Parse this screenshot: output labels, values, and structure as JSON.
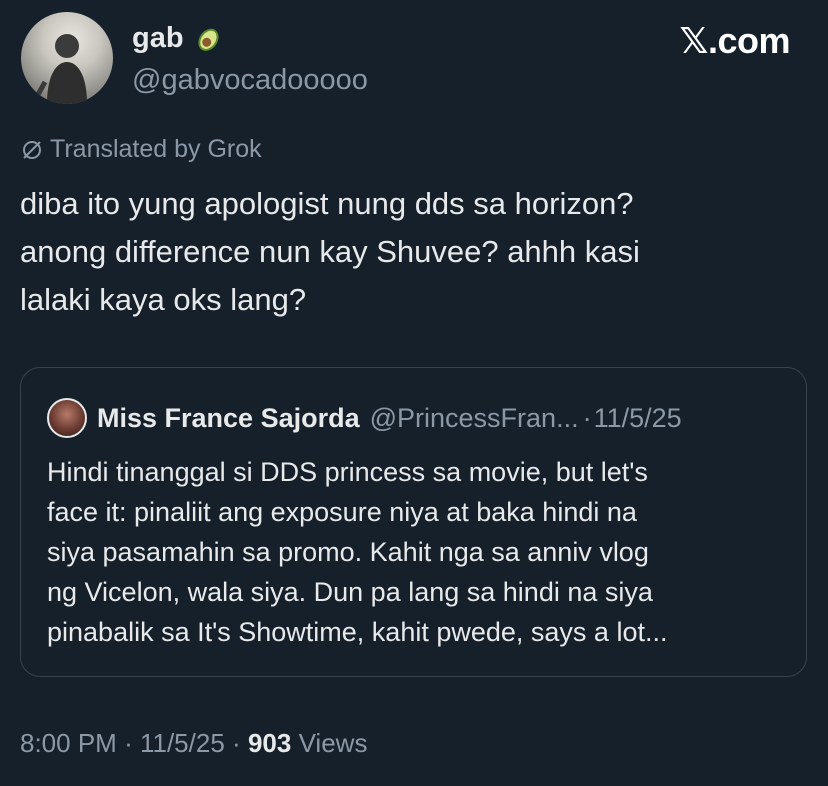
{
  "author": {
    "display_name": "gab",
    "name_emoji": "avocado-emoji",
    "handle": "@gabvocadooooo"
  },
  "brand": "𝕏.com",
  "translation_note": "Translated by Grok",
  "tweet_lines": [
    "diba ito yung apologist nung dds sa horizon?",
    "anong difference nun kay Shuvee? ahhh kasi",
    "lalaki kaya oks lang?"
  ],
  "quote": {
    "name": "Miss France Sajorda",
    "handle": "@PrincessFran...",
    "separator": "·",
    "date": "11/5/25",
    "lines": [
      "Hindi tinanggal si DDS princess sa movie, but let's",
      "face it: pinaliit ang exposure niya at baka hindi na",
      "siya pasamahin sa promo. Kahit nga sa anniv vlog",
      "ng Vicelon, wala siya. Dun pa lang sa hindi na siya",
      "pinabalik sa It's Showtime, kahit pwede, says a lot..."
    ]
  },
  "meta": {
    "time": "8:00 PM",
    "date": "11/5/25",
    "separator": "·",
    "views_count": "903",
    "views_label": "Views"
  },
  "colors": {
    "background": "#15202b",
    "primary_text": "#e7e9ea",
    "secondary_text": "#8b98a5",
    "border": "#38444d"
  }
}
